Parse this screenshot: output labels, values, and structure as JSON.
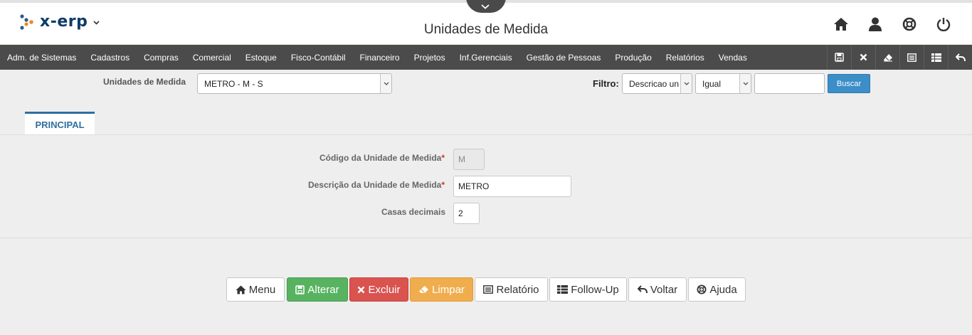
{
  "app": {
    "logo_text": "x-erp",
    "page_title": "Unidades de Medida"
  },
  "menu": {
    "items": [
      "Adm. de Sistemas",
      "Cadastros",
      "Compras",
      "Comercial",
      "Estoque",
      "Fisco-Contábil",
      "Financeiro",
      "Projetos",
      "Inf.Gerenciais",
      "Gestão de Pessoas",
      "Produção",
      "Relatórios",
      "Vendas"
    ]
  },
  "toolbar_icons": [
    "save-icon",
    "close-icon",
    "eraser-icon",
    "report-icon",
    "table-icon",
    "back-icon"
  ],
  "header_icons": [
    "home-icon",
    "user-icon",
    "help-icon",
    "power-icon"
  ],
  "filter": {
    "unit_label": "Unidades de Medida",
    "unit_selected": "METRO - M - S",
    "filtro_label": "Filtro:",
    "campo_selected": "Descricao un",
    "operador_selected": "Igual",
    "valor": "",
    "buscar_label": "Buscar"
  },
  "tabs": [
    {
      "label": "PRINCIPAL",
      "active": true
    }
  ],
  "form": {
    "codigo_label": "Código da Unidade de Medida",
    "codigo_value": "M",
    "descricao_label": "Descrição da Unidade de Medida",
    "descricao_value": "METRO",
    "casas_label": "Casas decimais",
    "casas_value": "2",
    "required_mark": "*"
  },
  "buttons": {
    "menu": "Menu",
    "alterar": "Alterar",
    "excluir": "Excluir",
    "limpar": "Limpar",
    "relatorio": "Relatório",
    "followup": "Follow-Up",
    "voltar": "Voltar",
    "ajuda": "Ajuda"
  },
  "colors": {
    "menubar": "#4b4b4b",
    "tab_accent": "#2f6f9f",
    "alterar": "#57b35f",
    "excluir": "#d9534f",
    "limpar": "#f0ad4e",
    "buscar": "#3b8ec8"
  }
}
